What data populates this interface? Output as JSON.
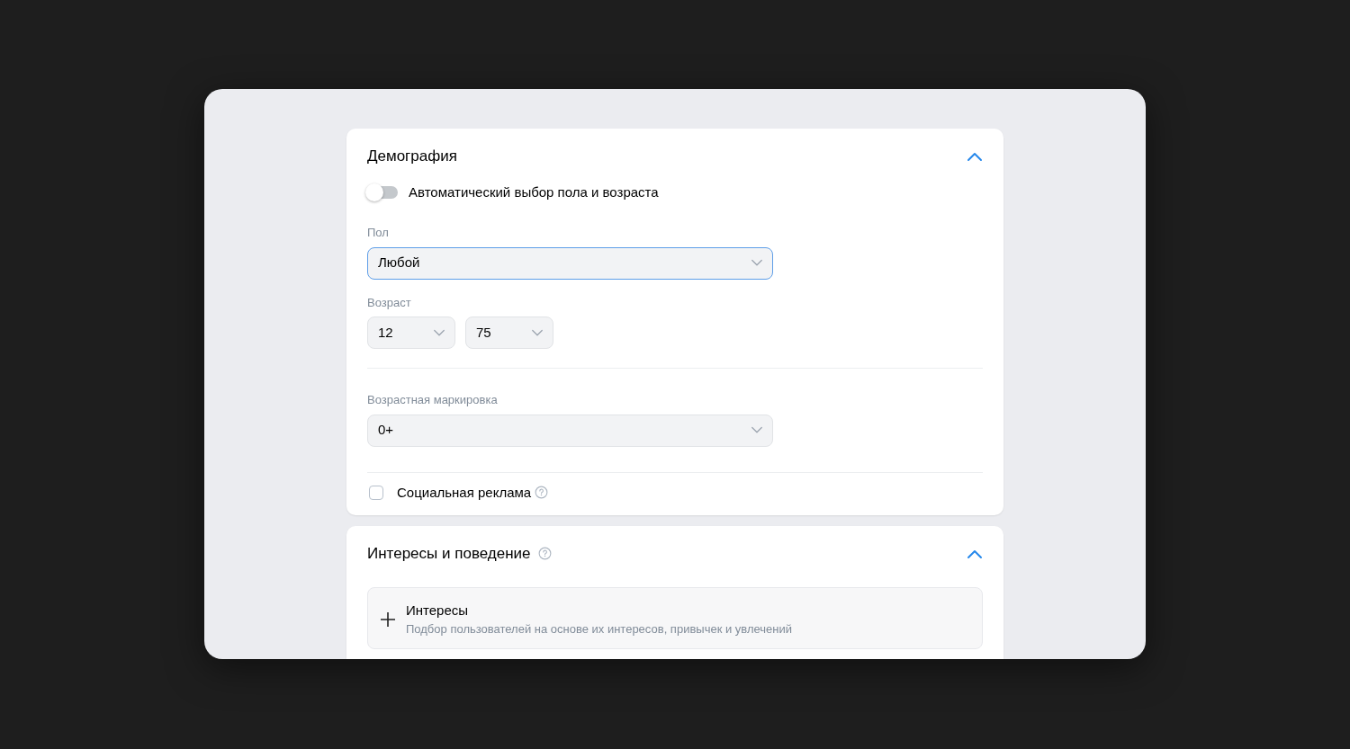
{
  "sections": [
    {
      "kind": "demography",
      "title": "Демография",
      "help": false,
      "expanded": true,
      "auto_toggle": {
        "label": "Автоматический выбор пола и возраста",
        "on": false
      },
      "gender": {
        "label": "Пол",
        "value": "Любой",
        "focused": true
      },
      "age": {
        "label": "Возраст",
        "from": {
          "value": "12",
          "focused": false
        },
        "to": {
          "value": "75",
          "focused": false
        }
      },
      "age_rating": {
        "label": "Возрастная маркировка",
        "value": "0+",
        "focused": false
      },
      "social_ad": {
        "label": "Социальная реклама",
        "checked": false,
        "help": true
      }
    },
    {
      "kind": "interests",
      "title": "Интересы и поведение",
      "help": true,
      "expanded": true,
      "items": [
        {
          "title": "Интересы",
          "description": "Подбор пользователей на основе их интересов, привычек и увлечений"
        }
      ]
    }
  ]
}
